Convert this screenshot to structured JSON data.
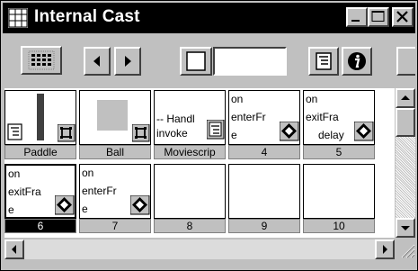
{
  "window": {
    "title": "Internal Cast",
    "controls": {
      "minimize": "minimize",
      "maximize": "maximize",
      "close": "close"
    }
  },
  "toolbar": {
    "cast_window_icon": "grid-icon",
    "prev_icon": "triangle-left-icon",
    "next_icon": "triangle-right-icon",
    "member_type_icon": "square-icon",
    "member_name_value": "",
    "script_icon": "script-icon",
    "info_icon": "info-icon"
  },
  "cast": {
    "members": [
      {
        "number": "",
        "name": "Paddle",
        "kind": "bitmap",
        "lines": [],
        "icon": "script-icon",
        "badge": "bitmap-icon"
      },
      {
        "number": "",
        "name": "Ball",
        "kind": "bitmap",
        "lines": [],
        "icon": "",
        "badge": "bitmap-icon"
      },
      {
        "number": "",
        "name": "Moviescrip",
        "kind": "movie-script",
        "lines": [
          "-- Handl",
          "invoke"
        ],
        "icon": "script-icon",
        "badge": ""
      },
      {
        "number": "4",
        "name": "",
        "kind": "behavior",
        "lines": [
          "on",
          "enterFr",
          "e"
        ],
        "icon": "",
        "badge": "behavior-icon"
      },
      {
        "number": "5",
        "name": "",
        "kind": "behavior",
        "lines": [
          "on",
          "exitFra",
          "delay"
        ],
        "icon": "",
        "badge": "behavior-icon"
      },
      {
        "number": "6",
        "name": "",
        "kind": "behavior",
        "lines": [
          "on",
          "exitFra",
          "e"
        ],
        "icon": "",
        "badge": "behavior-icon",
        "selected": true
      },
      {
        "number": "7",
        "name": "",
        "kind": "behavior",
        "lines": [
          "on",
          "enterFr",
          "e"
        ],
        "icon": "",
        "badge": "behavior-icon"
      },
      {
        "number": "8",
        "name": "",
        "kind": "empty",
        "lines": []
      },
      {
        "number": "9",
        "name": "",
        "kind": "empty",
        "lines": []
      },
      {
        "number": "10",
        "name": "",
        "kind": "empty",
        "lines": []
      }
    ]
  },
  "scrollbars": {
    "up_icon": "arrow-up-icon",
    "down_icon": "arrow-down-icon",
    "left_icon": "arrow-left-icon",
    "right_icon": "arrow-right-icon",
    "resize_icon": "resize-grip-icon"
  },
  "colors": {
    "title_bar": "#000000",
    "face": "#c0c0c0",
    "selected_caption": "#000000",
    "paddle_bar": "#404040",
    "ball": "#c0c0c0"
  }
}
